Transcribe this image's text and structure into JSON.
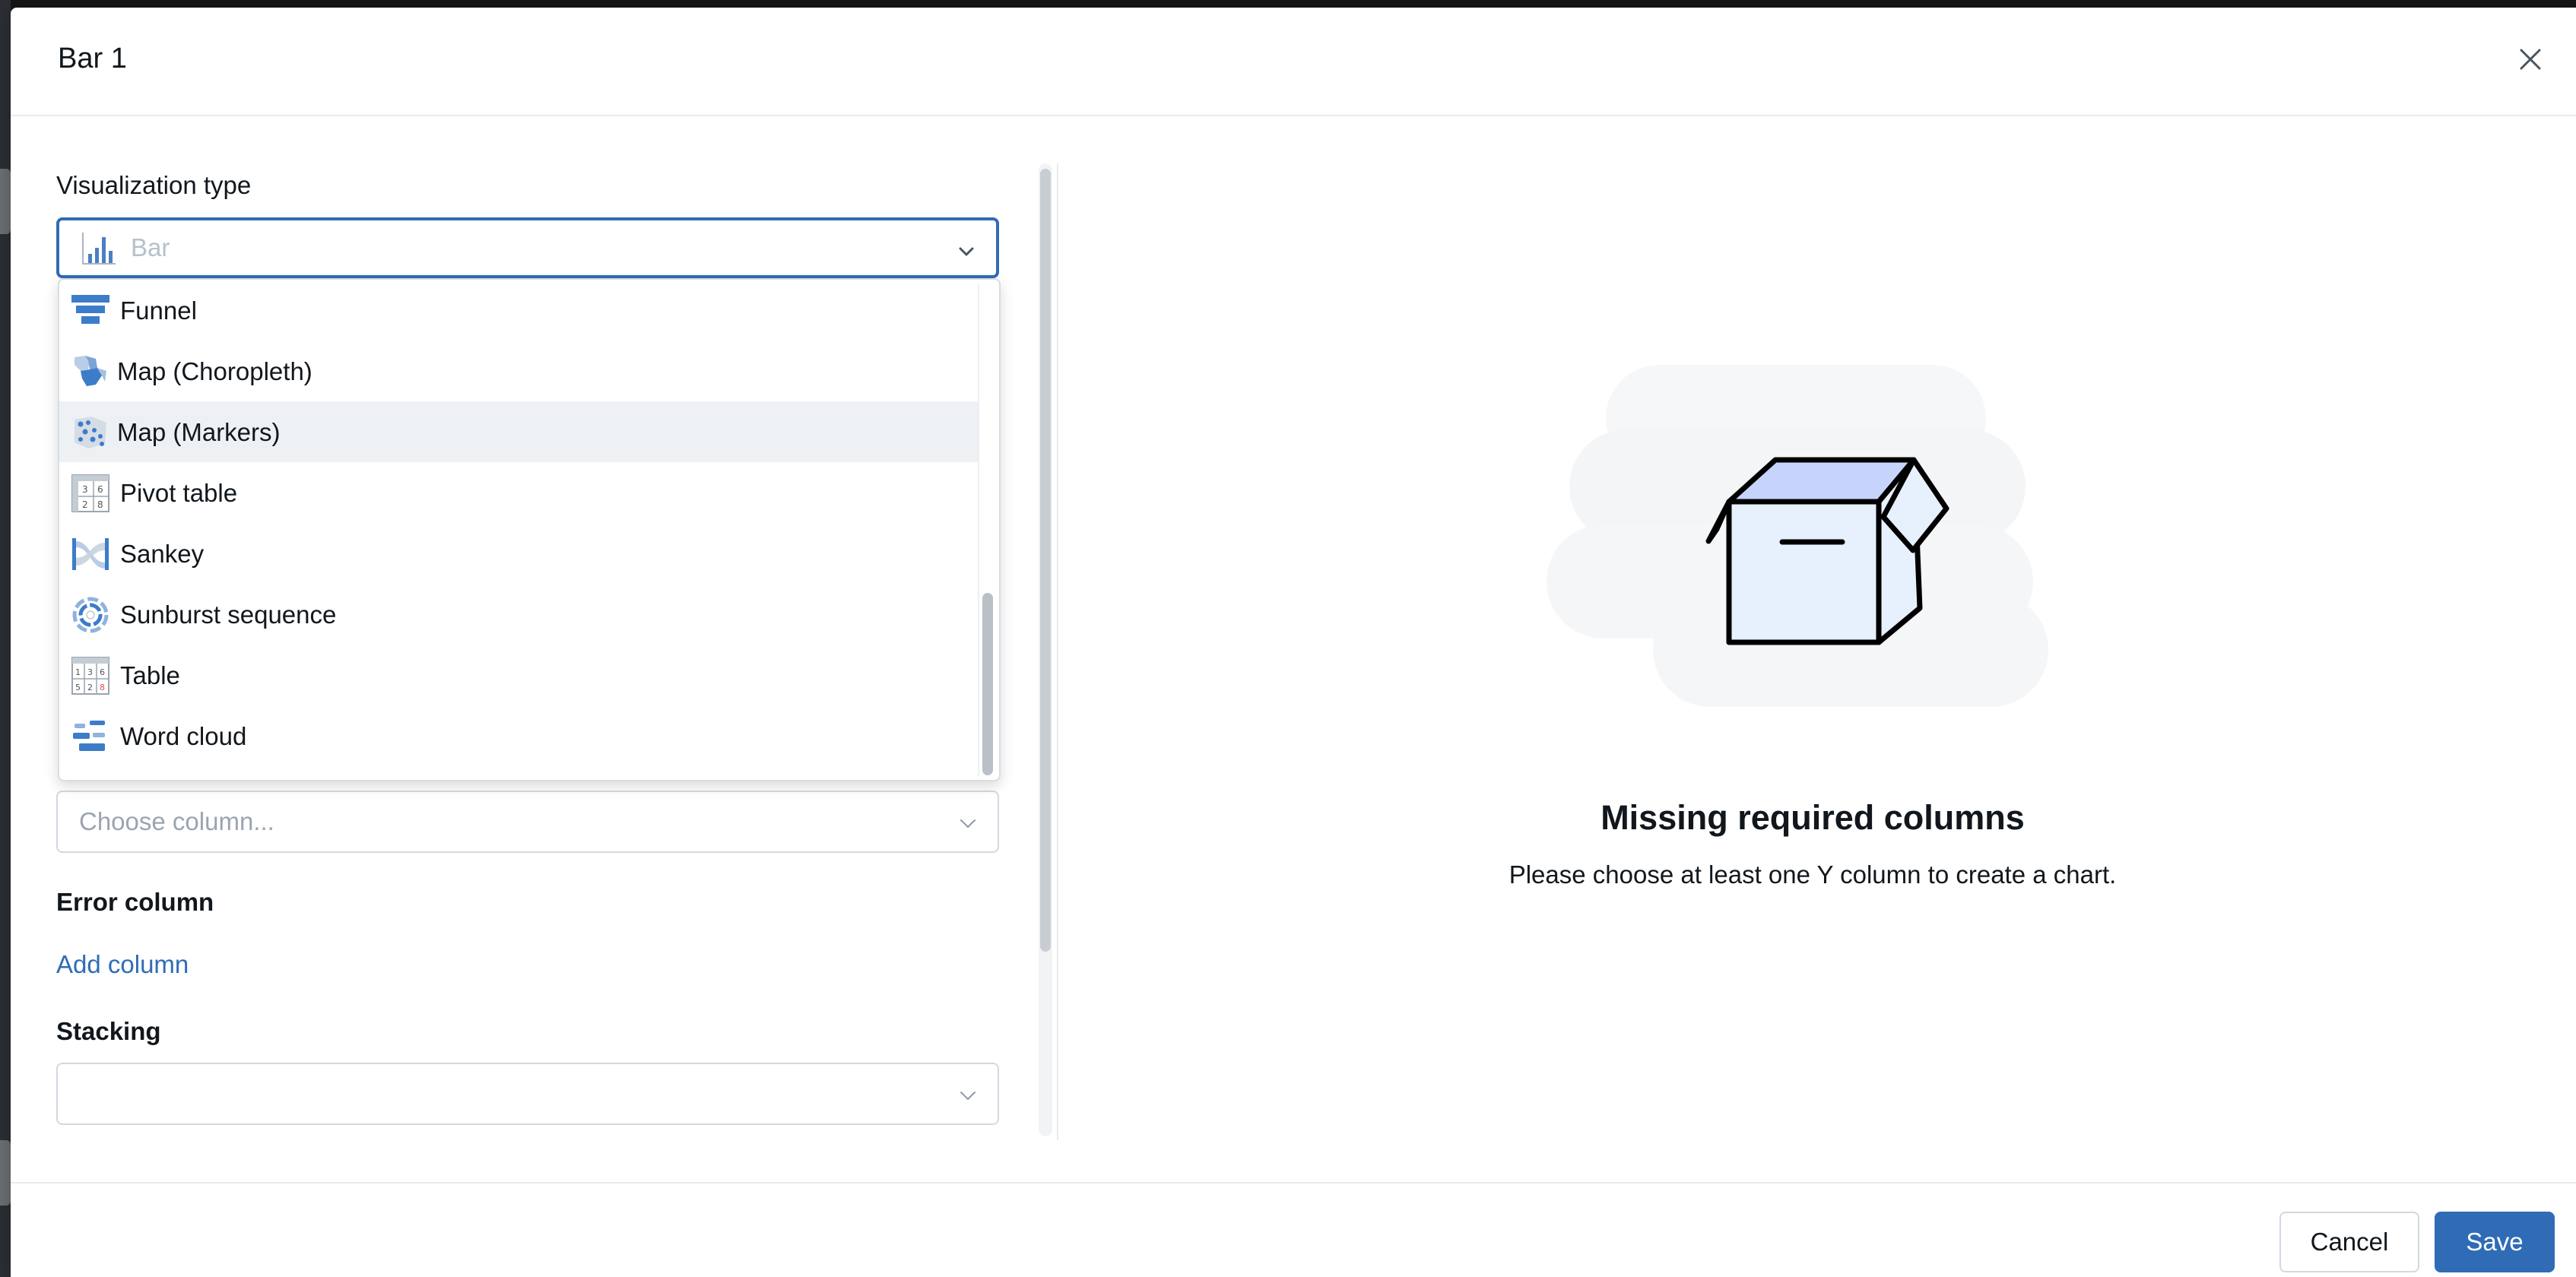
{
  "modal": {
    "title": "Bar 1"
  },
  "left_panel": {
    "viz_type_label": "Visualization type",
    "viz_type_value": "Bar",
    "dropdown_items": [
      {
        "label": "Funnel",
        "icon": "funnel-icon"
      },
      {
        "label": "Map (Choropleth)",
        "icon": "map-choropleth-icon"
      },
      {
        "label": "Map (Markers)",
        "icon": "map-markers-icon",
        "highlighted": true
      },
      {
        "label": "Pivot table",
        "icon": "pivot-table-icon"
      },
      {
        "label": "Sankey",
        "icon": "sankey-icon"
      },
      {
        "label": "Sunburst sequence",
        "icon": "sunburst-icon"
      },
      {
        "label": "Table",
        "icon": "table-icon"
      },
      {
        "label": "Word cloud",
        "icon": "word-cloud-icon"
      }
    ],
    "choose_column_placeholder": "Choose column...",
    "error_column_label": "Error column",
    "add_column_label": "Add column",
    "stacking_label": "Stacking"
  },
  "empty_state": {
    "title": "Missing required columns",
    "subtitle": "Please choose at least one Y column to create a chart."
  },
  "footer": {
    "cancel_label": "Cancel",
    "save_label": "Save"
  },
  "colors": {
    "accent": "#2f6cb5",
    "hover": "#eef1f4"
  }
}
